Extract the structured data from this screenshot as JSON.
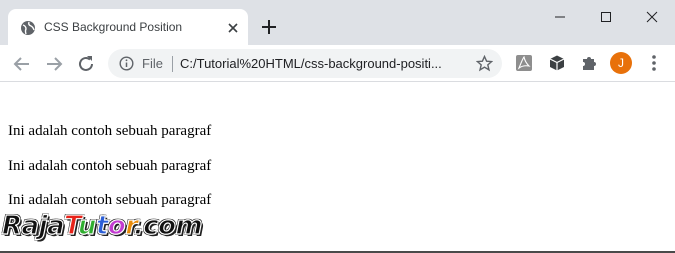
{
  "browser": {
    "tab_title": "CSS Background Position",
    "address_scheme_label": "File",
    "address_url": "C:/Tutorial%20HTML/css-background-positi...",
    "profile_initial": "J",
    "colors": {
      "titlebar": "#dee1e6",
      "omnibox": "#f1f3f4",
      "avatar": "#e8710a"
    },
    "icons": [
      "globe-icon",
      "close-icon",
      "plus-icon",
      "minimize-icon",
      "maximize-icon",
      "window-close-icon",
      "back-arrow-icon",
      "forward-arrow-icon",
      "reload-icon",
      "info-icon",
      "star-icon",
      "pdf-extension-icon",
      "cube-extension-icon",
      "puzzle-extension-icon",
      "kebab-menu-icon"
    ]
  },
  "page": {
    "paragraphs": [
      "Ini adalah contoh sebuah paragraf",
      "Ini adalah contoh sebuah paragraf",
      "Ini adalah contoh sebuah paragraf"
    ]
  },
  "watermark": {
    "parts": [
      "Raja",
      "T",
      "u",
      "t",
      "o",
      "r",
      ".com"
    ],
    "colors": [
      "#111111",
      "#e8231a",
      "#2fae2f",
      "#2c5fd6",
      "#c23bd0",
      "#e88a0a",
      "#111111"
    ]
  }
}
